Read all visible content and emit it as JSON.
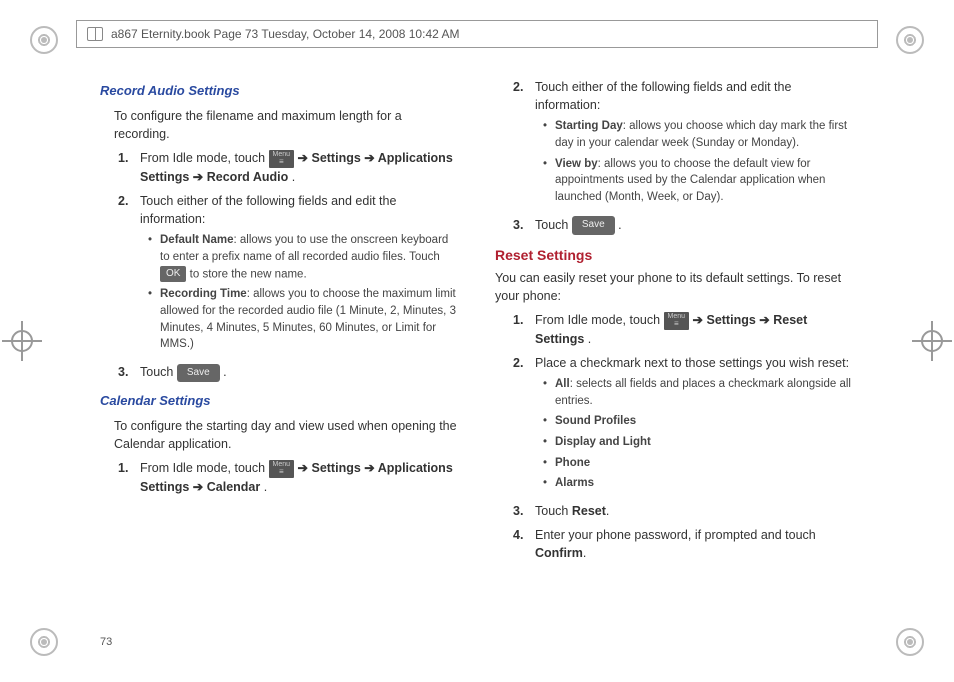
{
  "header": {
    "text": "a867 Eternity.book  Page 73  Tuesday, October 14, 2008  10:42 AM"
  },
  "page_number": "73",
  "icons": {
    "menu": "Menu",
    "save": "Save",
    "ok": "OK"
  },
  "left": {
    "h1": "Record Audio Settings",
    "intro": "To configure the filename and maximum length for a recording.",
    "s1_a": "From Idle mode, touch ",
    "s1_b": " ➔ ",
    "s1_settings": "Settings",
    "s1_c": " ➔ ",
    "s1_app": "Applications Settings",
    "s1_d": " ➔ ",
    "s1_rec": "Record Audio",
    "s1_e": ".",
    "s2": "Touch either of the following fields and edit the information:",
    "b1_name": "Default Name",
    "b1_a": ": allows you to use the onscreen keyboard to enter a prefix name of all recorded audio files. Touch ",
    "b1_b": " to store the new name.",
    "b2_name": "Recording Time",
    "b2_a": ": allows you to choose the maximum limit allowed for the recorded audio file (1 Minute, 2, Minutes, 3 Minutes, 4 Minutes, 5 Minutes, 60 Minutes, or Limit for MMS.)",
    "s3_a": "Touch ",
    "s3_b": " .",
    "h2": "Calendar Settings",
    "intro2": "To configure the starting day and view used when opening the Calendar application.",
    "c1_a": "From Idle mode, touch ",
    "c1_b": " ➔ ",
    "c1_settings": "Settings",
    "c1_c": " ➔ ",
    "c1_app": "Applications Settings",
    "c1_d": " ➔ ",
    "c1_cal": "Calendar",
    "c1_e": "."
  },
  "right": {
    "s2": "Touch either of the following fields and edit the information:",
    "b1_name": "Starting Day",
    "b1_a": ": allows you choose which day mark the first day in your calendar week (Sunday or Monday).",
    "b2_name": "View by",
    "b2_a": ": allows you to choose the default view for appointments used by the Calendar application when launched (Month, Week, or Day).",
    "s3_a": "Touch ",
    "s3_b": " .",
    "h_reset": "Reset Settings",
    "reset_intro": "You can easily reset your phone to its default settings. To reset your phone:",
    "r1_a": "From Idle mode, touch ",
    "r1_b": " ➔ ",
    "r1_settings": "Settings",
    "r1_c": "  ➔ ",
    "r1_reset": "Reset Settings",
    "r1_d": ".",
    "r2": "Place a checkmark next to those settings you wish reset:",
    "rb1_name": "All",
    "rb1_a": ": selects all fields and places a checkmark alongside all entries.",
    "rb2": "Sound Profiles",
    "rb3": "Display and Light",
    "rb4": "Phone",
    "rb5": "Alarms",
    "r3_a": "Touch ",
    "r3_reset": "Reset",
    "r3_b": ".",
    "r4_a": "Enter your phone password, if prompted and touch ",
    "r4_confirm": "Confirm",
    "r4_b": "."
  }
}
